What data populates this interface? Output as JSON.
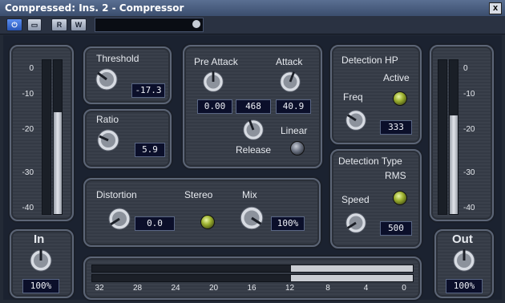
{
  "window": {
    "title": "Compressed: Ins. 2 - Compressor",
    "close_label": "x"
  },
  "toolbar": {
    "power_label": "⏻",
    "bypass_label": "▭",
    "read_label": "R",
    "write_label": "W",
    "preset_name": ""
  },
  "input": {
    "label": "In",
    "gain": "100%",
    "scale": [
      "0",
      "-10",
      "-20",
      "-30",
      "-40"
    ],
    "levels": [
      0.0,
      0.66
    ]
  },
  "threshold": {
    "label": "Threshold",
    "value": "-17.3"
  },
  "ratio": {
    "label": "Ratio",
    "value": "5.9"
  },
  "attack_section": {
    "pre_attack_label": "Pre Attack",
    "pre_attack_value": "0.00",
    "hold_value": "468",
    "attack_label": "Attack",
    "attack_value": "40.9",
    "release_label": "Release",
    "linear_label": "Linear",
    "linear_on": false
  },
  "detection_hp": {
    "label": "Detection HP",
    "active_label": "Active",
    "active_on": true,
    "freq_label": "Freq",
    "freq_value": "333"
  },
  "detection_type": {
    "label": "Detection Type",
    "mode_label": "RMS",
    "mode_on": true,
    "speed_label": "Speed",
    "speed_value": "500"
  },
  "distortion_section": {
    "distortion_label": "Distortion",
    "distortion_value": "0.0",
    "stereo_label": "Stereo",
    "stereo_on": true,
    "mix_label": "Mix",
    "mix_value": "100%"
  },
  "gain_reduction": {
    "scale": [
      "32",
      "28",
      "24",
      "20",
      "16",
      "12",
      "8",
      "4",
      "0"
    ],
    "levels": [
      0.38,
      0.38
    ]
  },
  "output": {
    "label": "Out",
    "gain": "100%",
    "scale": [
      "0",
      "-10",
      "-20",
      "-30",
      "-40"
    ],
    "levels": [
      0.0,
      0.64
    ]
  }
}
